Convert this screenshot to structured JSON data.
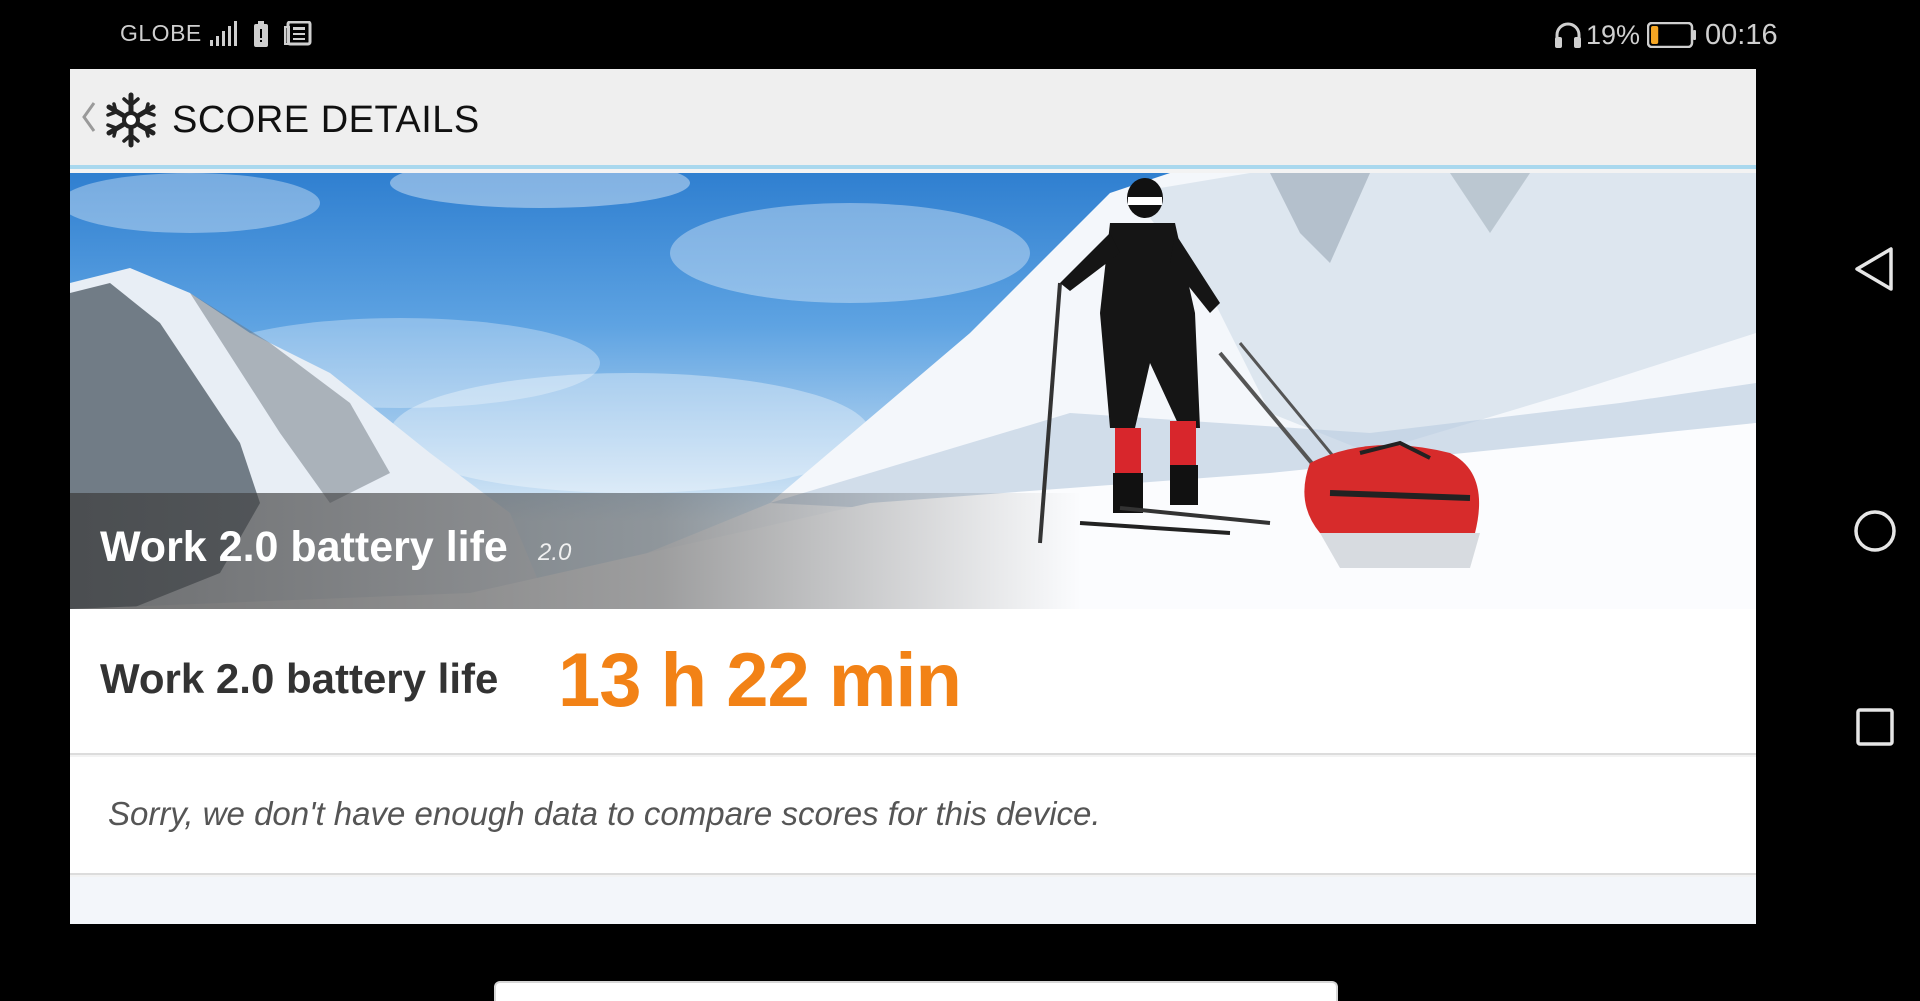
{
  "status_bar": {
    "carrier": "GLOBE",
    "battery_percent": "19%",
    "battery_level": 0.19,
    "time": "00:16",
    "icons": [
      "signal-icon",
      "battery-saver-icon",
      "news-icon",
      "headphones-icon",
      "battery-icon"
    ]
  },
  "header": {
    "title": "SCORE DETAILS",
    "back_icon": "chevron-left-icon",
    "logo_icon": "snowflake-icon"
  },
  "hero": {
    "title": "Work 2.0 battery life",
    "version": "2.0"
  },
  "result": {
    "label": "Work 2.0 battery life",
    "value": "13 h 22 min",
    "value_color": "#f28216"
  },
  "message": {
    "text": "Sorry, we don't have enough data to compare scores for this device."
  },
  "nav_bar": {
    "icons": [
      "back-triangle-icon",
      "home-circle-icon",
      "recents-square-icon"
    ]
  }
}
